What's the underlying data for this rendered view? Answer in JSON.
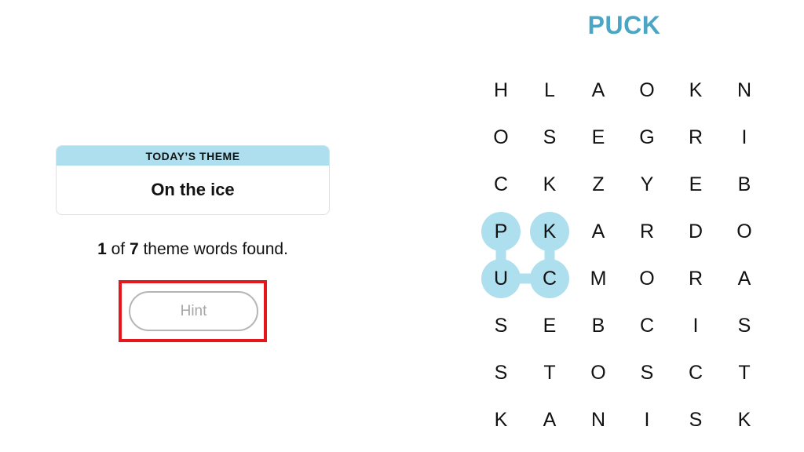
{
  "theme": {
    "header": "TODAY’S THEME",
    "value": "On the ice"
  },
  "progress": {
    "found": "1",
    "of_text": " of ",
    "total": "7",
    "suffix": " theme words found."
  },
  "hint_button": {
    "label": "Hint"
  },
  "current_word": "PUCK",
  "colors": {
    "selected_fill": "#aedfee",
    "current_word": "#4aa6c4",
    "highlight_frame": "#e3171c"
  },
  "grid": {
    "rows": [
      [
        "H",
        "L",
        "A",
        "O",
        "K",
        "N"
      ],
      [
        "O",
        "S",
        "E",
        "G",
        "R",
        "I"
      ],
      [
        "C",
        "K",
        "Z",
        "Y",
        "E",
        "B"
      ],
      [
        "P",
        "K",
        "A",
        "R",
        "D",
        "O"
      ],
      [
        "U",
        "C",
        "M",
        "O",
        "R",
        "A"
      ],
      [
        "S",
        "E",
        "B",
        "C",
        "I",
        "S"
      ],
      [
        "S",
        "T",
        "O",
        "S",
        "C",
        "T"
      ],
      [
        "K",
        "A",
        "N",
        "I",
        "S",
        "K"
      ]
    ],
    "selected_path": [
      [
        3,
        0
      ],
      [
        4,
        0
      ],
      [
        4,
        1
      ],
      [
        3,
        1
      ]
    ]
  }
}
